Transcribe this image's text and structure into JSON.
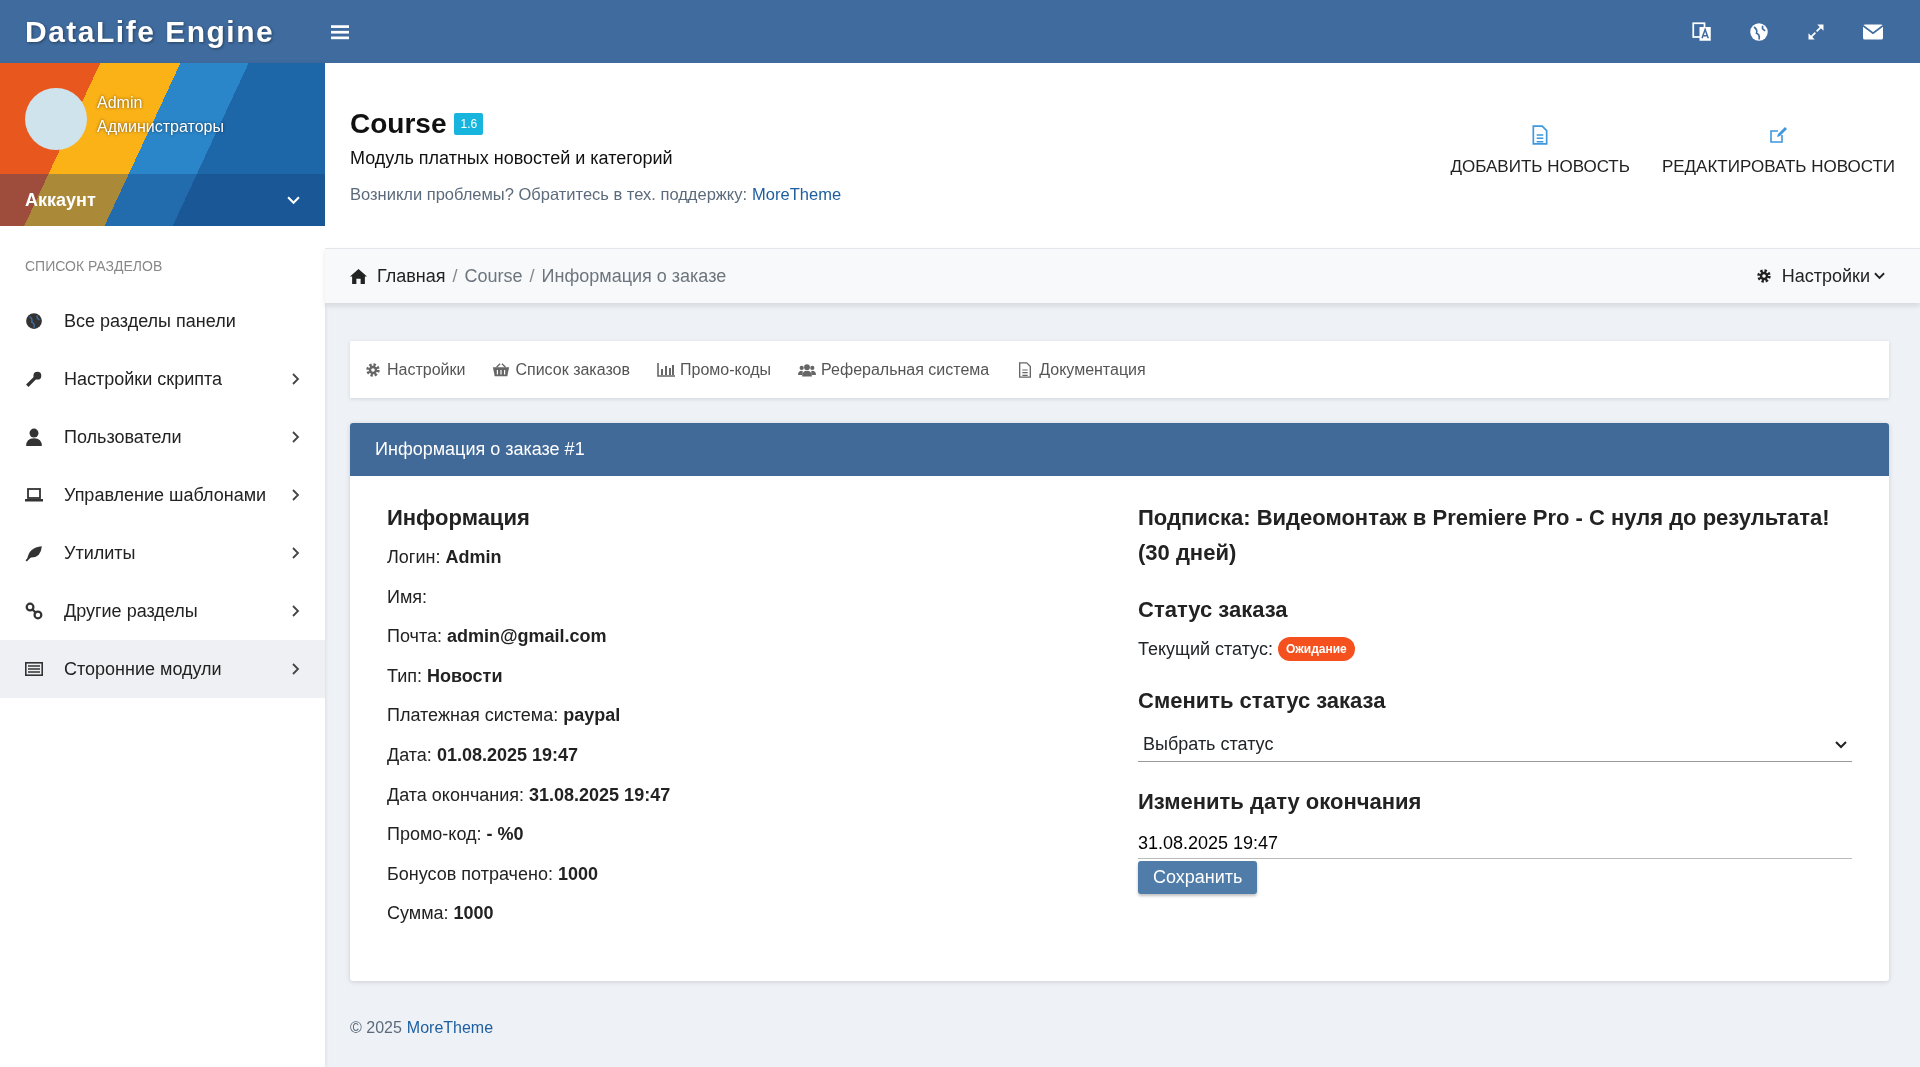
{
  "brand": "DataLife Engine",
  "user": {
    "name": "Admin",
    "group": "Администраторы",
    "menu_label": "Аккаунт"
  },
  "sidebar": {
    "heading": "СПИСОК РАЗДЕЛОВ",
    "items": [
      {
        "label": "Все разделы панели",
        "expandable": false,
        "selected": false
      },
      {
        "label": "Настройки скрипта",
        "expandable": true,
        "selected": false
      },
      {
        "label": "Пользователи",
        "expandable": true,
        "selected": false
      },
      {
        "label": "Управление шаблонами",
        "expandable": true,
        "selected": false
      },
      {
        "label": "Утилиты",
        "expandable": true,
        "selected": false
      },
      {
        "label": "Другие разделы",
        "expandable": true,
        "selected": false
      },
      {
        "label": "Сторонние модули",
        "expandable": true,
        "selected": true
      }
    ]
  },
  "header": {
    "title": "Course",
    "version": "1.6",
    "subtitle": "Модуль платных новостей и категорий",
    "support_text": "Возникли проблемы? Обратитесь в тех. поддержку:",
    "support_link": "MoreTheme",
    "actions": [
      {
        "label": "ДОБАВИТЬ НОВОСТЬ"
      },
      {
        "label": "РЕДАКТИРОВАТЬ НОВОСТИ"
      }
    ]
  },
  "breadcrumb": {
    "items": [
      "Главная",
      "Course",
      "Информация о заказе"
    ],
    "separators": [
      "/",
      "/"
    ],
    "settings": "Настройки"
  },
  "tabs": [
    "Настройки",
    "Список заказов",
    "Промо-коды",
    "Реферальная система",
    "Документация"
  ],
  "panel": {
    "title": "Информация о заказе #1",
    "info_heading": "Информация",
    "fields": [
      "Логин: **Admin**",
      "Имя:",
      "Почта: **admin@gmail.com**",
      "Тип: **Новости**",
      "Платежная система: **paypal**",
      "Дата: **01.08.2025 19:47**",
      "Дата окончания: **31.08.2025 19:47**",
      "Промо-код: **- %0**",
      "Бонусов потрачено: **1000**",
      "Сумма: **1000**"
    ],
    "subscription": "Подписка: Видеомонтаж в Premiere Pro - С нуля до результата! (30 дней)",
    "status_heading": "Статус заказа",
    "status_label": "Текущий статус:",
    "status_badge": "Ожидание",
    "change_heading": "Сменить статус заказа",
    "status_select": "Выбрать статус",
    "date_heading": "Изменить дату окончания",
    "end_date": "31.08.2025 19:47",
    "save_button": "Сохранить"
  },
  "footer": {
    "text": "© 2025",
    "link": "MoreTheme"
  }
}
